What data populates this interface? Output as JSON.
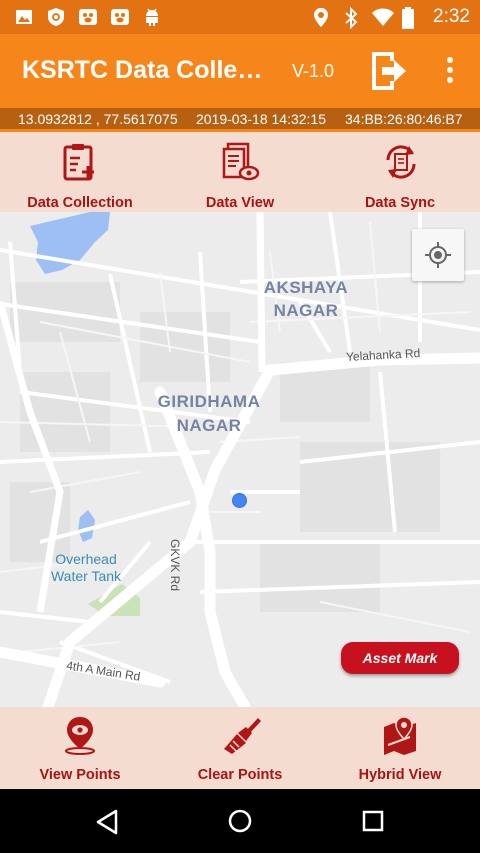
{
  "status_bar": {
    "time": "2:32",
    "left_icons": [
      "image-icon",
      "shield-icon",
      "paw-app-icon",
      "paw-app-icon",
      "android-icon"
    ],
    "right_icons": [
      "location-icon",
      "bluetooth-icon",
      "wifi-icon",
      "battery-icon"
    ]
  },
  "app_bar": {
    "title": "KSRTC Data Collec…",
    "version": "V-1.0"
  },
  "info_strip": {
    "coordinates": "13.0932812 , 77.5617075",
    "datetime": "2019-03-18 14:32:15",
    "device_id": "34:BB:26:80:46:B7"
  },
  "top_nav": [
    {
      "label": "Data Collection",
      "icon": "clipboard-add-icon"
    },
    {
      "label": "Data View",
      "icon": "document-eye-icon"
    },
    {
      "label": "Data Sync",
      "icon": "sync-icon"
    }
  ],
  "map": {
    "labels": {
      "akshaya_1": "AKSHAYA",
      "akshaya_2": "NAGAR",
      "giridhama_1": "GIRIDHAMA",
      "giridhama_2": "NAGAR",
      "yelahanka_rd": "Yelahanka Rd",
      "gkvk_rd": "GKVK Rd",
      "main_rd": "4th A Main Rd",
      "overhead_1": "Overhead",
      "overhead_2": "Water Tank"
    },
    "asset_button": "Asset Mark"
  },
  "bottom_nav": [
    {
      "label": "View Points",
      "icon": "map-pin-eye-icon"
    },
    {
      "label": "Clear Points",
      "icon": "brush-icon"
    },
    {
      "label": "Hybrid View",
      "icon": "map-fold-pin-icon"
    }
  ],
  "colors": {
    "status_bar": "#e27212",
    "app_bar": "#f7861a",
    "nav_bg": "#f4dcd0",
    "nav_text": "#a81414",
    "asset_button": "#c7111f"
  }
}
